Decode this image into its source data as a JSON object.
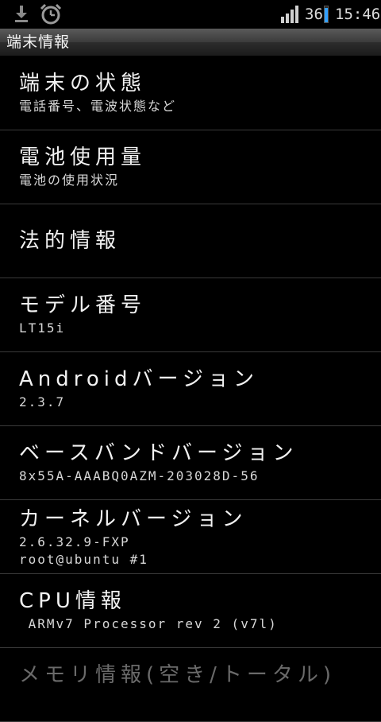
{
  "status_bar": {
    "signal_text": "36",
    "time": "15:46",
    "battery_level_percent": 90,
    "icons": [
      "download-icon",
      "alarm-clock-icon",
      "signal-strength-icon",
      "battery-icon"
    ],
    "battery_color": "#32a0ff"
  },
  "title_bar": {
    "title": "端末情報"
  },
  "items": [
    {
      "title": "端末の状態",
      "subtitle": "電話番号、電波状態など"
    },
    {
      "title": "電池使用量",
      "subtitle": "電池の使用状況"
    },
    {
      "title": "法的情報"
    },
    {
      "title": "モデル番号",
      "subtitle": "LT15i"
    },
    {
      "title": "Androidバージョン",
      "subtitle": "2.3.7"
    },
    {
      "title": "ベースバンドバージョン",
      "subtitle": "8x55A-AAABQ0AZM-203028D-56"
    },
    {
      "title": "カーネルバージョン",
      "subtitle": "2.6.32.9-FXP",
      "subtitle2": "root@ubuntu #1"
    },
    {
      "title": "CPU情報",
      "subtitle": " ARMv7 Processor rev 2 (v7l)"
    },
    {
      "title": "メモリ情報(空き/トータル)"
    }
  ]
}
